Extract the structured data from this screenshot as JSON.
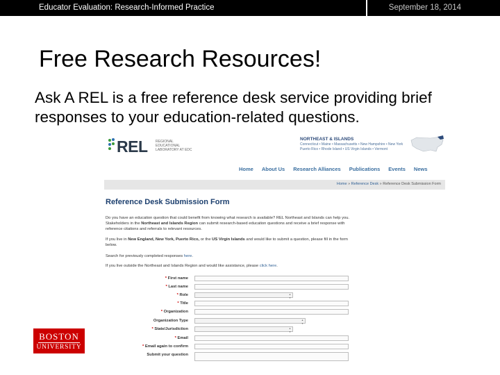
{
  "header": {
    "left_text": "Educator Evaluation: Research-Informed Practice",
    "right_text": "September 18, 2014"
  },
  "slide": {
    "title": "Free Research Resources!",
    "body": "Ask A REL is a free reference desk service providing brief responses to your education-related questions."
  },
  "screenshot": {
    "logo_text": "REL",
    "logo_subtitle": "REGIONAL EDUCATIONAL LABORATORY AT EDC",
    "region_title": "NORTHEAST & ISLANDS",
    "region_subtitle": "Connecticut • Maine • Massachusetts • New Hampshire • New York Puerto Rico • Rhode Island • US Virgin Islands • Vermont",
    "nav": [
      "Home",
      "About Us",
      "Research Alliances",
      "Publications",
      "Events",
      "News"
    ],
    "breadcrumb": {
      "home": "Home",
      "sep": "»",
      "reference_desk": "Reference Desk",
      "current": "Reference Desk Submission Form"
    },
    "form_title": "Reference Desk Submission Form",
    "paragraphs": {
      "p1_a": "Do you have an education question that could benefit from knowing what research is available? REL Northeast and Islands can help you. Stakeholders in the ",
      "p1_b": "Northeast and Islands Region",
      "p1_c": " can submit research-based education questions and receive a brief response with reference citations and referrals to relevant resources.",
      "p2_a": "If you live in ",
      "p2_b": "New England, New York, Puerto Rico,",
      "p2_c": " or the ",
      "p2_d": "US Virgin Islands",
      "p2_e": " and would like to submit a question, please fill in the form below.",
      "p3_a": "Search for previously completed responses ",
      "p3_link": "here",
      "p3_b": ".",
      "p4_a": "If you live outside the Northeast and Islands Region and would like assistance, please ",
      "p4_link": "click here",
      "p4_b": "."
    },
    "fields": [
      {
        "label": "First name",
        "type": "input"
      },
      {
        "label": "Last name",
        "type": "input"
      },
      {
        "label": "Role",
        "type": "select"
      },
      {
        "label": "Title",
        "type": "input"
      },
      {
        "label": "Organization",
        "type": "input"
      },
      {
        "label": "Organization Type",
        "type": "select"
      },
      {
        "label": "State/Jurisdiction",
        "type": "select"
      },
      {
        "label": "Email",
        "type": "input"
      },
      {
        "label": "Email again to confirm",
        "type": "input"
      },
      {
        "label": "Submit your question",
        "type": "input"
      }
    ]
  },
  "footer_logo": {
    "line1": "BOSTON",
    "line2": "UNIVERSITY",
    "color": "#cc0000"
  }
}
